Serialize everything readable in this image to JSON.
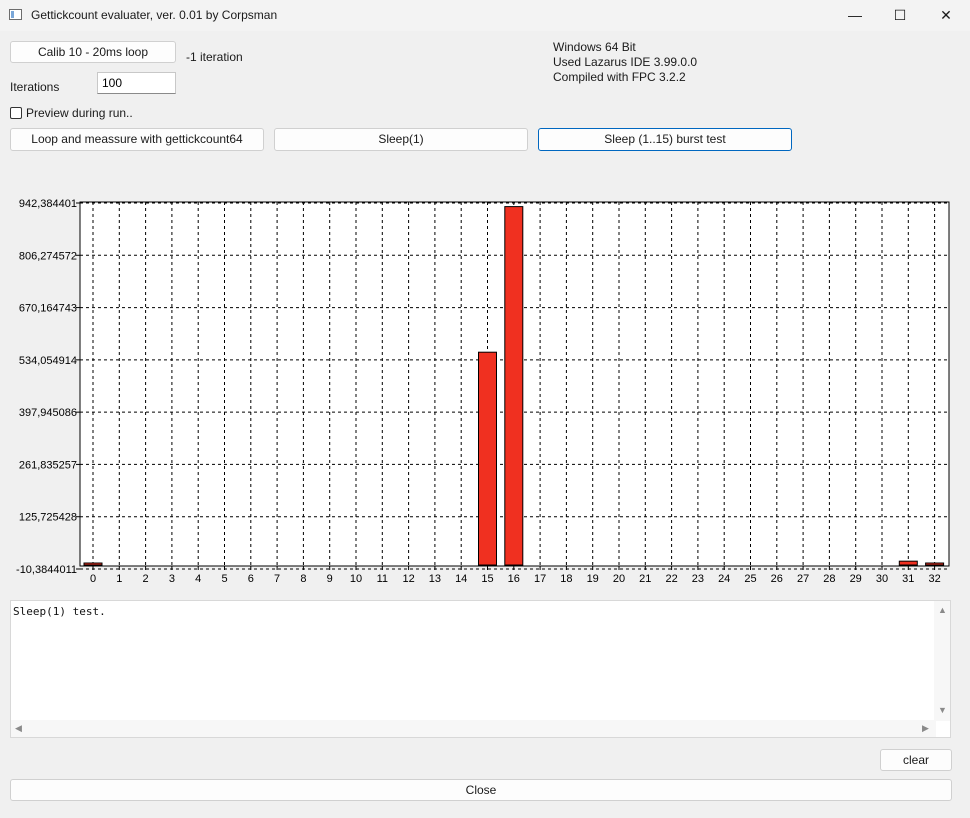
{
  "window": {
    "title": "Gettickcount evaluater, ver. 0.01 by Corpsman",
    "minimize": "—",
    "maximize": "☐",
    "close": "✕"
  },
  "controls": {
    "calib_button": "Calib 10 - 20ms loop",
    "iteration_status": "-1 iteration",
    "iterations_label": "Iterations",
    "iterations_value": "100",
    "preview_label": "Preview during run..",
    "loop_button": "Loop and meassure with gettickcount64",
    "sleep_button": "Sleep(1)",
    "burst_button": "Sleep (1..15) burst test"
  },
  "info": {
    "line1": "Windows 64 Bit",
    "line2": "Used Lazarus IDE 3.99.0.0",
    "line3": "Compiled with FPC 3.2.2"
  },
  "chart_data": {
    "type": "bar",
    "title": "",
    "xlabel": "",
    "ylabel": "",
    "categories": [
      "0",
      "1",
      "2",
      "3",
      "4",
      "5",
      "6",
      "7",
      "8",
      "9",
      "10",
      "11",
      "12",
      "13",
      "14",
      "15",
      "16",
      "17",
      "18",
      "19",
      "20",
      "21",
      "22",
      "23",
      "24",
      "25",
      "26",
      "27",
      "28",
      "29",
      "30",
      "31",
      "32"
    ],
    "values": [
      3,
      0,
      0,
      0,
      0,
      0,
      0,
      0,
      0,
      0,
      0,
      0,
      0,
      0,
      0,
      554,
      933,
      0,
      0,
      0,
      0,
      0,
      0,
      0,
      0,
      0,
      0,
      0,
      0,
      0,
      0,
      10,
      1
    ],
    "yticks": [
      "942,384401",
      "806,274572",
      "670,164743",
      "534,054914",
      "397,945086",
      "261,835257",
      "125,725428",
      "-10,3844011"
    ],
    "ylim": [
      -10.3844011,
      942.384401
    ],
    "grid": true,
    "bar_color": "#f03020"
  },
  "memo": {
    "text": "Sleep(1) test."
  },
  "buttons": {
    "clear": "clear",
    "close": "Close"
  }
}
